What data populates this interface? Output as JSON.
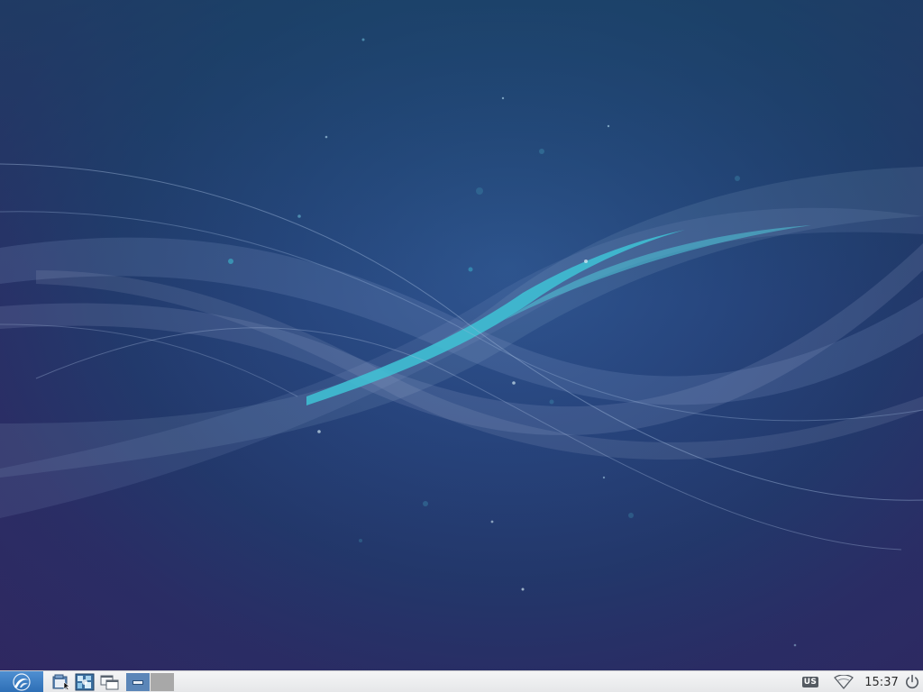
{
  "desktop": {
    "wallpaper": "lubuntu-waves-wallpaper"
  },
  "taskbar": {
    "start_menu_icon": "lubuntu-logo-icon",
    "launchers": [
      {
        "name": "file-manager",
        "icon": "folder-icon"
      },
      {
        "name": "web-browser",
        "icon": "browser-icon"
      },
      {
        "name": "show-desktop",
        "icon": "windows-icon"
      }
    ],
    "workspaces": [
      {
        "index": 1,
        "active": true
      },
      {
        "index": 2,
        "active": false
      }
    ],
    "tray": {
      "keyboard_layout": "US",
      "network_icon": "wifi-icon",
      "clock": "15:37",
      "power_icon": "power-icon"
    }
  },
  "colors": {
    "taskbar_bg": "#eceef0",
    "start_button": "#3a7cc3",
    "wallpaper_accent": "#3ec3d6"
  }
}
